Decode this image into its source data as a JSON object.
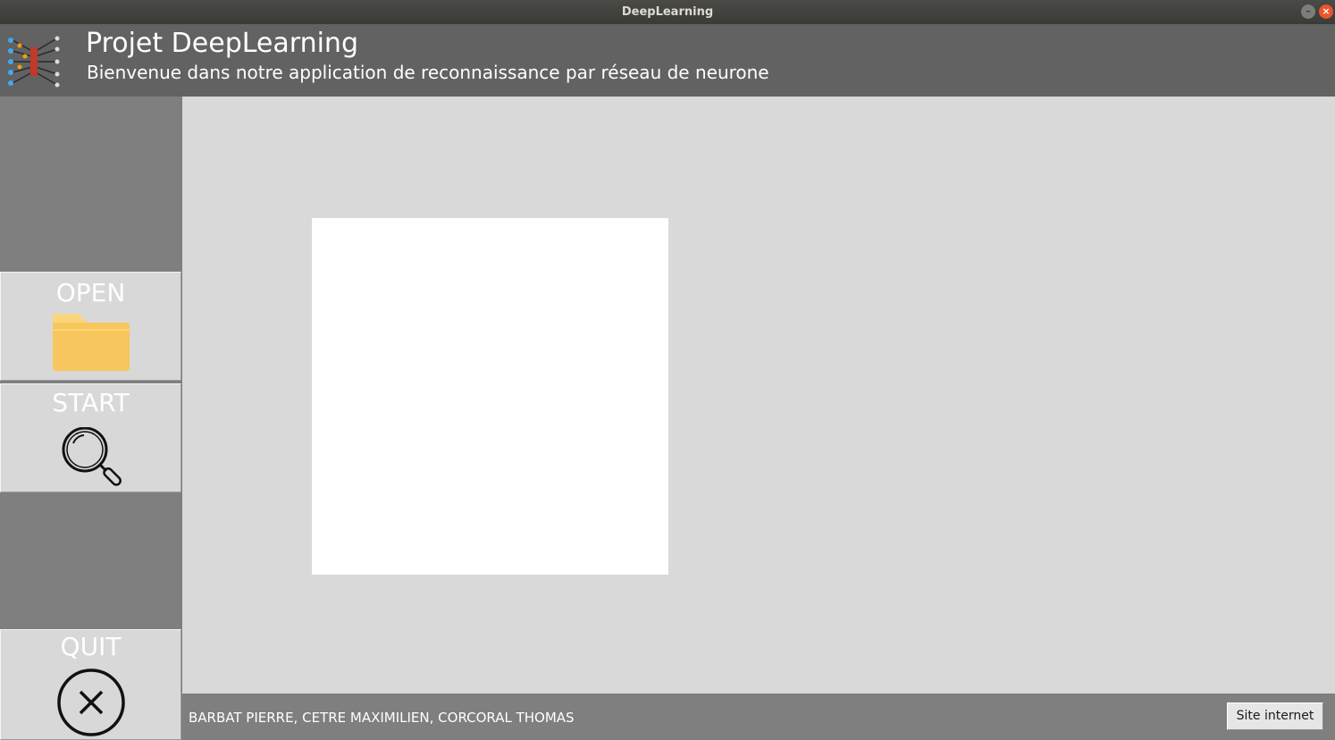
{
  "window": {
    "title": "DeepLearning",
    "controls": {
      "minimize_icon": "minimize-icon",
      "close_icon": "close-icon"
    }
  },
  "header": {
    "logo_icon": "neural-network-icon",
    "title": "Projet DeepLearning",
    "subtitle": "Bienvenue dans notre application de reconnaissance par réseau de neurone"
  },
  "sidebar": {
    "buttons": [
      {
        "label": "OPEN",
        "icon": "folder-icon"
      },
      {
        "label": "START",
        "icon": "magnifier-icon"
      },
      {
        "label": "QUIT",
        "icon": "close-circle-icon"
      }
    ]
  },
  "footer": {
    "authors": "BARBAT PIERRE, CETRE MAXIMILIEN, CORCORAL THOMAS",
    "site_button": "Site internet"
  },
  "colors": {
    "header_bg": "#616261",
    "sidebar_bg": "#7f7f7f",
    "main_bg": "#d9d9d9",
    "folder": "#f7c65c",
    "close_button": "#e9552c"
  }
}
